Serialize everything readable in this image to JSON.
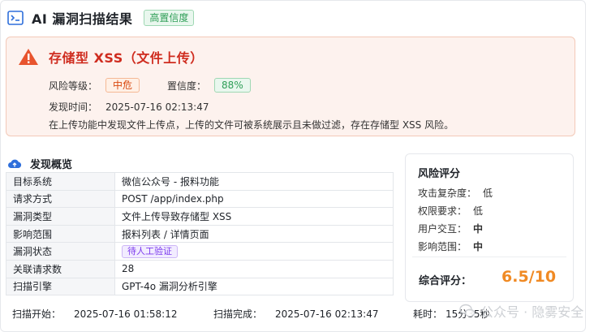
{
  "header": {
    "title": "AI 漏洞扫描结果",
    "confidence_tag": "高置信度"
  },
  "alert": {
    "title": "存储型 XSS（文件上传）",
    "risk_label": "风险等级：",
    "risk_value": "中危",
    "confidence_label": "置信度：",
    "confidence_value": "88%",
    "time_label": "发现时间：",
    "time_value": "2025-07-16 02:13:47",
    "description": "在上传功能中发现文件上传点，上传的文件可被系统展示且未做过滤，存在存储型 XSS 风险。"
  },
  "overview": {
    "title": "发现概览",
    "rows": [
      {
        "key": "目标系统",
        "value": "微信公众号 - 报料功能"
      },
      {
        "key": "请求方式",
        "value": "POST /app/index.php"
      },
      {
        "key": "漏洞类型",
        "value": "文件上传导致存储型 XSS"
      },
      {
        "key": "影响范围",
        "value": "报料列表 / 详情页面"
      },
      {
        "key": "漏洞状态",
        "value": "待人工验证"
      },
      {
        "key": "关联请求数",
        "value": "28"
      },
      {
        "key": "扫描引擎",
        "value": "GPT-4o 漏洞分析引擎"
      }
    ]
  },
  "risk": {
    "title": "风险评分",
    "items": [
      {
        "label": "攻击复杂度：",
        "value": "低"
      },
      {
        "label": "权限要求：",
        "value": "低"
      },
      {
        "label": "用户交互：",
        "value": "中"
      },
      {
        "label": "影响范围：",
        "value": "中"
      }
    ],
    "score_label": "综合评分：",
    "score_value": "6.5/10"
  },
  "footer": {
    "start_label": "扫描开始：",
    "start_value": "2025-07-16 01:58:12",
    "end_label": "扫描完成：",
    "end_value": "2025-07-16 02:13:47",
    "duration_label": "耗时：",
    "duration_value": "15分35秒"
  },
  "watermark": "公众号 · 隐雾安全",
  "colors": {
    "danger": "#cf2c1f",
    "success": "#2f9e57",
    "warning": "#f08a24",
    "purple": "#7c3aed"
  }
}
